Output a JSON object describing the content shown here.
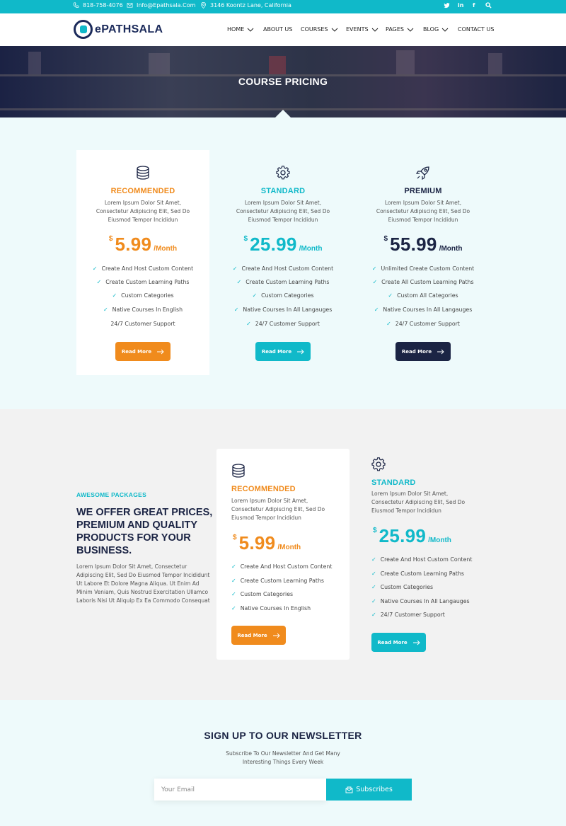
{
  "topbar": {
    "phone": "818-758-4076",
    "email": "Info@Epathsala.Com",
    "address": "3146 Koontz Lane, California",
    "social": [
      "twitter-icon",
      "linkedin-icon",
      "facebook-icon",
      "search-icon"
    ]
  },
  "brand": {
    "name": "ePATHSALA"
  },
  "nav": {
    "home": "HOME",
    "about": "ABOUT US",
    "courses": "COURSES",
    "events": "EVENTS",
    "pages": "PAGES",
    "blog": "BLOG",
    "contact": "CONTACT US"
  },
  "hero": {
    "title": "COURSE PRICING"
  },
  "plans": [
    {
      "name": "RECOMMENDED",
      "icon": "database-icon",
      "desc": "Lorem Ipsum Dolor Sit Amet, Consectetur Adipiscing Elit, Sed Do Eiusmod Tempor Incididun",
      "currency": "$",
      "price": "5.99",
      "period": "/Month",
      "features": [
        "Create And Host Custom Content",
        "Create Custom Learning Paths",
        "Custom Categories",
        "Native Courses In English",
        "24/7 Customer Support"
      ],
      "button": "Read More"
    },
    {
      "name": "STANDARD",
      "icon": "gear-icon",
      "desc": "Lorem Ipsum Dolor Sit Amet, Consectetur Adipiscing Elit, Sed Do Eiusmod Tempor Incididun",
      "currency": "$",
      "price": "25.99",
      "period": "/Month",
      "features": [
        "Create And Host Custom Content",
        "Create Custom Learning Paths",
        "Custom Categories",
        "Native Courses In All Langauges",
        "24/7 Customer Support"
      ],
      "button": "Read More"
    },
    {
      "name": "PREMIUM",
      "icon": "rocket-icon",
      "desc": "Lorem Ipsum Dolor Sit Amet, Consectetur Adipiscing Elit, Sed Do Eiusmod Tempor Incididun",
      "currency": "$",
      "price": "55.99",
      "period": "/Month",
      "features": [
        "Unlimited Create Custom Content",
        "Create All Custom Learning Paths",
        "Custom All Categories",
        "Native Courses In All Langauges",
        "24/7 Customer Support"
      ],
      "button": "Read More"
    }
  ],
  "packages": {
    "eyebrow": "AWESOME PACKAGES",
    "title_lines": [
      "WE OFFER GREAT PRICES,",
      "PREMIUM AND QUALITY",
      "PRODUCTS FOR YOUR",
      "BUSINESS."
    ],
    "body": "Lorem Ipsum Dolor Sit Amet, Consectetur Adipiscing Elit, Sed Do Eiusmod Tempor Incididunt Ut Labore Et Dolore Magna Aliqua. Ut Enim Ad Minim Veniam, Quis Nostrud Exercitation Ullamco Laboris Nisi Ut Aliquip Ex Ea Commodo Consequat",
    "cards": [
      {
        "name": "RECOMMENDED",
        "icon": "database-icon",
        "desc": "Lorem Ipsum Dolor Sit Amet, Consectetur Adipiscing Elit, Sed Do Eiusmod Tempor Incididun",
        "currency": "$",
        "price": "5.99",
        "period": "/Month",
        "features": [
          "Create And Host Custom Content",
          "Create Custom Learning Paths",
          "Custom Categories",
          "Native Courses In English"
        ],
        "button": "Read More"
      },
      {
        "name": "STANDARD",
        "icon": "gear-icon",
        "desc": "Lorem Ipsum Dolor Sit Amet, Consectetur Adipiscing Elit, Sed Do Eiusmod Tempor Incididun",
        "currency": "$",
        "price": "25.99",
        "period": "/Month",
        "features": [
          "Create And Host Custom Content",
          "Create Custom Learning Paths",
          "Custom Categories",
          "Native Courses In All Langauges",
          "24/7 Customer Support"
        ],
        "button": "Read More"
      }
    ]
  },
  "newsletter": {
    "title": "SIGN UP TO OUR NEWSLETTER",
    "subtitle": "Subscribe To Our Newsletter And Get Many Interesting Things Every Week",
    "placeholder": "Your Email",
    "button": "Subscribes"
  },
  "colors": {
    "teal": "#10b9c9",
    "orange": "#f08b1d",
    "navy": "#1b2444"
  }
}
